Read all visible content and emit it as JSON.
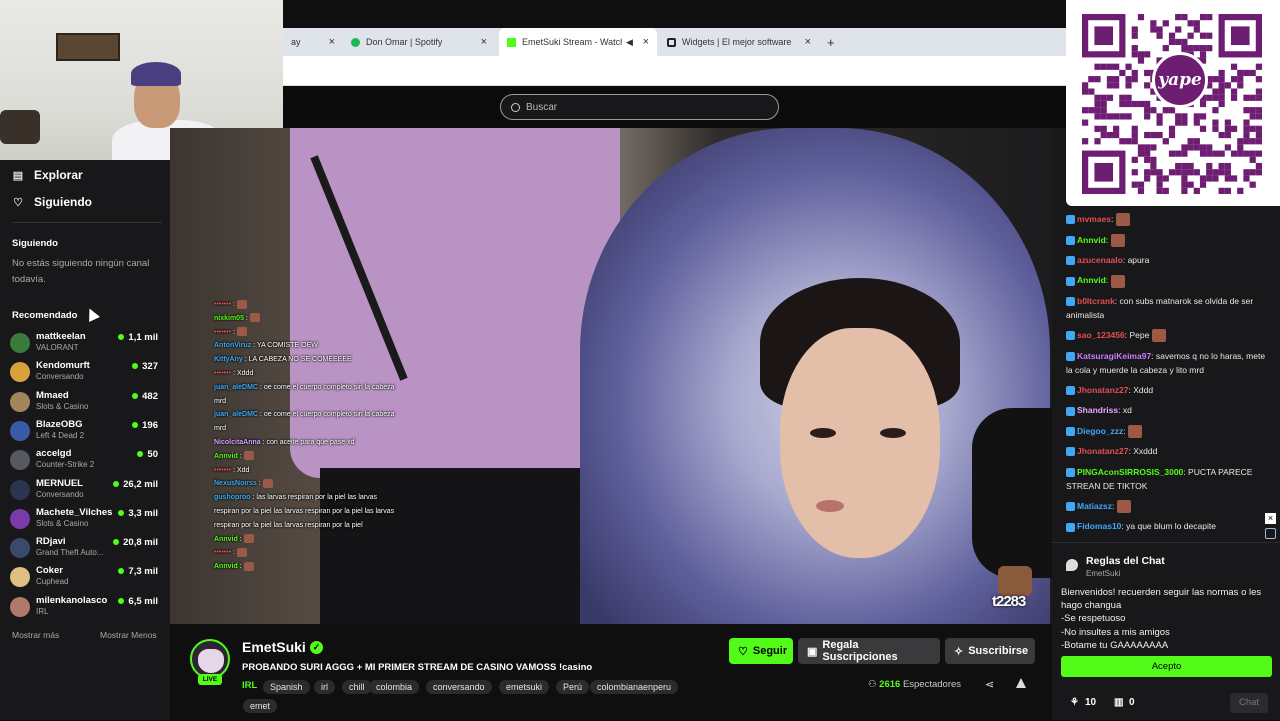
{
  "browser": {
    "tabs": [
      {
        "label": "ay",
        "active": false
      },
      {
        "label": "Don Omar | Spotify",
        "active": false
      },
      {
        "label": "EmetSuki Stream - Watch L",
        "active": true
      },
      {
        "label": "Widgets | El mejor software para",
        "active": false
      }
    ],
    "new_tab": "+"
  },
  "header": {
    "search_placeholder": "Buscar"
  },
  "sidebar": {
    "nav": [
      {
        "label": "Explorar",
        "icon": "compass-icon"
      },
      {
        "label": "Siguiendo",
        "icon": "heart-icon"
      }
    ],
    "following_title": "Siguiendo",
    "following_empty": "No estás siguiendo ningún canal todavía.",
    "recommended_title": "Recomendado",
    "recommended": [
      {
        "name": "mattkeelan",
        "category": "VALORANT",
        "viewers": "1,1 mil",
        "color": "#3a7a3a"
      },
      {
        "name": "Kendomurft",
        "category": "Conversando",
        "viewers": "327",
        "color": "#d8a23a"
      },
      {
        "name": "Mmaed",
        "category": "Slots & Casino",
        "viewers": "482",
        "color": "#a0865a"
      },
      {
        "name": "BlazeOBG",
        "category": "Left 4 Dead 2",
        "viewers": "196",
        "color": "#3a5aa8"
      },
      {
        "name": "accelgd",
        "category": "Counter-Strike 2",
        "viewers": "50",
        "color": "#555a60"
      },
      {
        "name": "MERNUEL",
        "category": "Conversando",
        "viewers": "26,2 mil",
        "color": "#2a3550"
      },
      {
        "name": "Machete_Vilches",
        "category": "Slots & Casino",
        "viewers": "3,3 mil",
        "color": "#7a3aa8"
      },
      {
        "name": "RDjavi",
        "category": "Grand Theft Auto...",
        "viewers": "20,8 mil",
        "color": "#3a4a6a"
      },
      {
        "name": "Coker",
        "category": "Cuphead",
        "viewers": "7,3 mil",
        "color": "#e0c080"
      },
      {
        "name": "milenkanolasco",
        "category": "IRL",
        "viewers": "6,5 mil",
        "color": "#b07a6a"
      }
    ],
    "show_more": "Mostrar más",
    "show_less": "Mostrar Menos"
  },
  "overlay_chat": [
    {
      "user": "•••••••",
      "text": "",
      "color": "#e05050",
      "emote": true
    },
    {
      "user": "nixkim05",
      "text": "",
      "color": "#53fc18",
      "emote": true
    },
    {
      "user": "•••••••",
      "text": "",
      "color": "#e05050",
      "emote": true
    },
    {
      "user": "AntonViruz",
      "text": "YA COMISTE OEW",
      "color": "#3fa9f5",
      "emote": false
    },
    {
      "user": "KittyAny",
      "text": "LA CABEZA NO SE COMEEEEE",
      "color": "#3fa9f5",
      "emote": false
    },
    {
      "user": "•••••••",
      "text": "Xddd",
      "color": "#e05050",
      "emote": false
    },
    {
      "user": "juan_aleDMC",
      "text": "oe come el cuerpo completo sin la cabeza mrd",
      "color": "#3fa9f5",
      "emote": false
    },
    {
      "user": "juan_aleDMC",
      "text": "oe come el cuerpo completo sin la cabeza mrd",
      "color": "#3fa9f5",
      "emote": false
    },
    {
      "user": "NicolcitaAnna",
      "text": "con aceite para que pase xd",
      "color": "#d9a3ff",
      "emote": false
    },
    {
      "user": "Annvid",
      "text": "",
      "color": "#53fc18",
      "emote": true
    },
    {
      "user": "•••••••",
      "text": "Xdd",
      "color": "#e05050",
      "emote": false
    },
    {
      "user": "NexusNoirss",
      "text": "",
      "color": "#3fa9f5",
      "emote": true
    },
    {
      "user": "gushoproo",
      "text": "las larvas respiran por la piel las larvas respiran por la piel las larvas respiran por la piel las larvas respiran por la piel las larvas respiran por la piel",
      "color": "#3fa9f5",
      "emote": false
    },
    {
      "user": "Annvid",
      "text": "",
      "color": "#53fc18",
      "emote": true
    },
    {
      "user": "•••••••",
      "text": "",
      "color": "#e05050",
      "emote": true
    },
    {
      "user": "Annvid",
      "text": "",
      "color": "#53fc18",
      "emote": true
    }
  ],
  "video": {
    "sticker_text": "t2283"
  },
  "stream": {
    "channel": "EmetSuki",
    "title": "PROBANDO SURI AGGG + MI PRIMER STREAM DE CASINO VAMOSS !casino",
    "category": "IRL",
    "live_label": "LIVE",
    "tags": [
      "Spanish",
      "irl",
      "chill",
      "colombia",
      "conversando",
      "emetsuki",
      "Perú",
      "colombianaenperu",
      "emet"
    ],
    "follow": "Seguir",
    "gift": "Regala Suscripciones",
    "subscribe": "Suscribirse",
    "viewers_count": "2616",
    "viewers_label": "Espectadores"
  },
  "chat": {
    "messages": [
      {
        "user": "mvmaes",
        "text": "",
        "color": "#e05050",
        "emote": true
      },
      {
        "user": "Annvid",
        "text": "",
        "color": "#53fc18",
        "emote": true
      },
      {
        "user": "azucenaalo",
        "text": "apura",
        "color": "#e05050",
        "emote": false
      },
      {
        "user": "Annvid",
        "text": "",
        "color": "#53fc18",
        "emote": true
      },
      {
        "user": "b0ltcrank",
        "text": "con subs matnarok se olvida de ser animalista",
        "color": "#e05050",
        "emote": false
      },
      {
        "user": "sao_123456",
        "text": "Pepe",
        "color": "#e05050",
        "emote": true
      },
      {
        "user": "KatsuragiKeima97",
        "text": "savemos q no lo haras, mete la cola y muerde la cabeza y lito mrd",
        "color": "#c77dff",
        "emote": false
      },
      {
        "user": "Jhonatanz27",
        "text": "Xddd",
        "color": "#e05050",
        "emote": false
      },
      {
        "user": "Shandriss",
        "text": "xd",
        "color": "#e7a6ff",
        "emote": false
      },
      {
        "user": "Diegoo_zzz",
        "text": "",
        "color": "#3fa9f5",
        "emote": true
      },
      {
        "user": "Jhonatanz27",
        "text": "Xxddd",
        "color": "#e05050",
        "emote": false
      },
      {
        "user": "PINGAconSIRROSIS_3000",
        "text": "PUCTA PARECE STREAN DE TIKTOK",
        "color": "#53fc18",
        "emote": false
      },
      {
        "user": "Matiazsz",
        "text": "",
        "color": "#3fa9f5",
        "emote": true
      },
      {
        "user": "Fidomas10",
        "text": "ya que blum lo decapite",
        "color": "#3fa9f5",
        "emote": false
      }
    ],
    "rules_title": "Reglas del Chat",
    "rules_channel": "EmetSuki",
    "rules_lines": [
      "Bienvenidos! recuerden seguir las normas o les hago changua",
      "-Se respetuoso",
      "-No insultes a mis amigos",
      "-Botame tu GAAAAAAAA"
    ],
    "accept": "Acepto",
    "kicks": "10",
    "gifts": "0",
    "send": "Chat"
  },
  "colors": {
    "accent": "#53fc18",
    "qr_purple": "#6e1e72"
  },
  "qr": {
    "logo_text": "yape"
  }
}
